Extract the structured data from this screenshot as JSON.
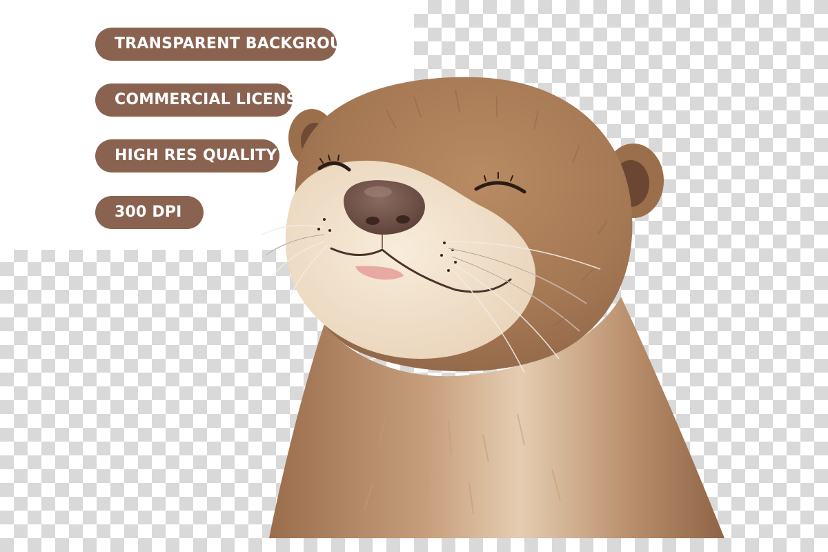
{
  "colors": {
    "badge_background": "#8a6250",
    "checker_dark": "#d9d9d9",
    "checker_light": "#ffffff",
    "otter_fur": "#a97b57",
    "otter_muzzle": "#f3e4cf",
    "otter_nose": "#6e4f46"
  },
  "badges": [
    {
      "label": "TRANSPARENT BACKGROUND"
    },
    {
      "label": "COMMERCIAL LICENSE"
    },
    {
      "label": "HIGH RES QUALITY"
    },
    {
      "label": "300 DPI"
    }
  ],
  "illustration": {
    "subject": "otter-icon",
    "expression": "smiling, eyes closed"
  }
}
